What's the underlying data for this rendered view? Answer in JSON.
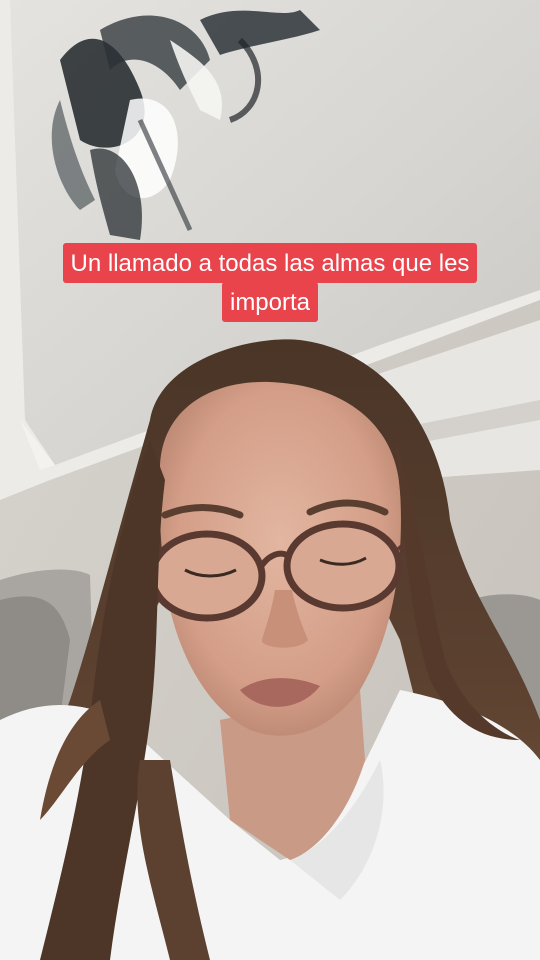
{
  "video": {
    "caption_lines": [
      "Un llamado a todas las almas que les",
      "importa"
    ]
  },
  "colors": {
    "caption_background": "#e9444c",
    "caption_text": "#ffffff"
  }
}
